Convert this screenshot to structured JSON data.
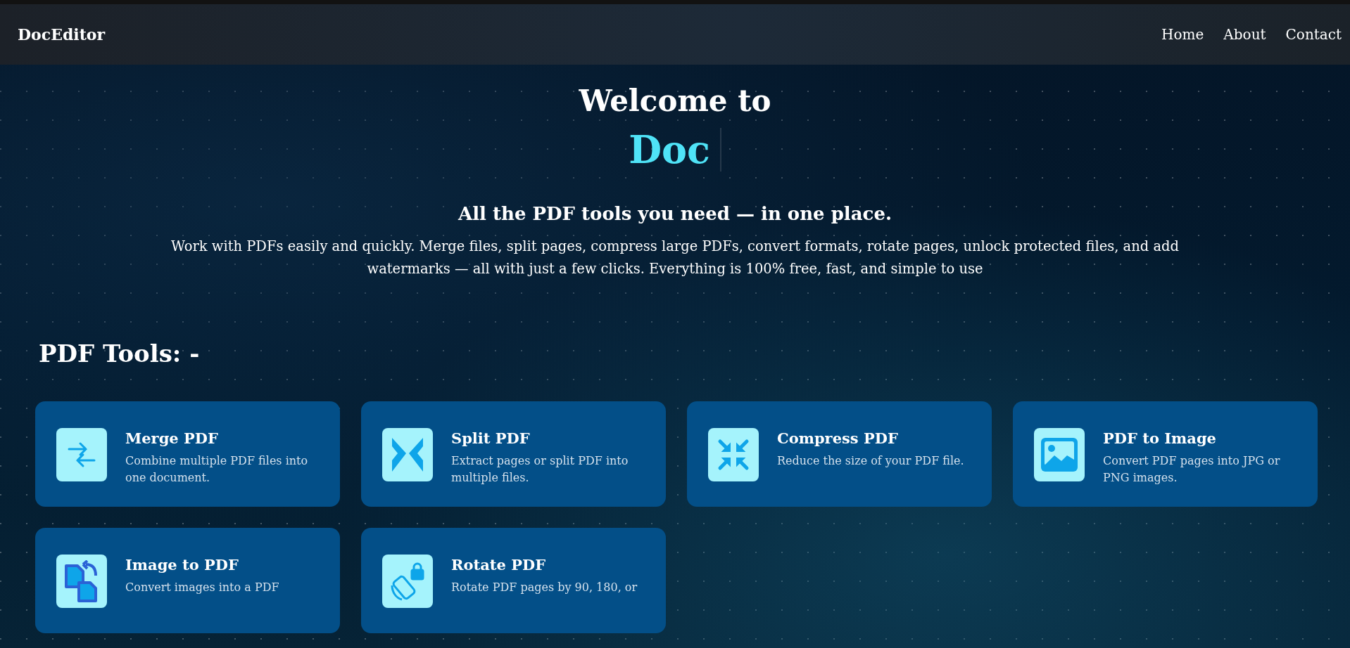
{
  "navbar": {
    "logo": "DocEditor",
    "links": [
      "Home",
      "About",
      "Contact"
    ]
  },
  "hero": {
    "heading": "Welcome to",
    "highlight": "Doc",
    "tagline": "All the PDF tools you need — in one place.",
    "description": "Work with PDFs easily and quickly. Merge files, split pages, compress large PDFs, convert formats, rotate pages, unlock protected files, and add watermarks — all with just a few clicks. Everything is 100% free, fast, and simple to use"
  },
  "tools": {
    "heading": "PDF Tools: -",
    "cards": [
      {
        "title": "Merge PDF",
        "description": "Combine multiple PDF files into one document."
      },
      {
        "title": "Split PDF",
        "description": "Extract pages or split PDF into multiple files."
      },
      {
        "title": "Compress PDF",
        "description": "Reduce the size of your PDF file."
      },
      {
        "title": "PDF to Image",
        "description": "Convert PDF pages into JPG or PNG images."
      },
      {
        "title": "Image to PDF",
        "description": "Convert images into a PDF"
      },
      {
        "title": "Rotate PDF",
        "description": "Rotate PDF pages by 90, 180, or"
      }
    ]
  }
}
